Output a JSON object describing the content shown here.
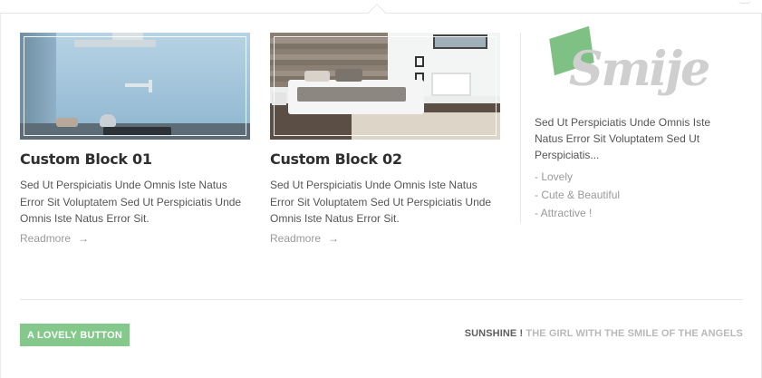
{
  "blocks": [
    {
      "title": "Custom Block 01",
      "text": "Sed Ut Perspiciatis Unde Omnis Iste Natus Error Sit Voluptatem Sed Ut Perspiciatis Unde Omnis Iste Natus Error Sit.",
      "readmore": "Readmore",
      "image": "kitchen-photo"
    },
    {
      "title": "Custom Block 02",
      "text": "Sed Ut Perspiciatis Unde Omnis Iste Natus Error Sit Voluptatem Sed Ut Perspiciatis Unde Omnis Iste Natus Error Sit.",
      "readmore": "Readmore",
      "image": "bedroom-photo"
    }
  ],
  "side": {
    "logo_text": "Smije",
    "text": "Sed Ut Perspiciatis Unde Omnis Iste Natus Error Sit Voluptatem Sed Ut Perspiciatis...",
    "list": [
      "- Lovely",
      "- Cute & Beautiful",
      "- Attractive !"
    ]
  },
  "footer": {
    "button_label": "A LOVELY BUTTON",
    "tagline_strong": "SUNSHINE !",
    "tagline_light": "THE GIRL WITH THE SMILE OF THE ANGELS"
  },
  "colors": {
    "accent": "#84c88b",
    "heading": "#2f2f2f",
    "muted": "#9a9a9a"
  },
  "icons": {
    "readmore_arrow": "arrow-right-icon"
  }
}
